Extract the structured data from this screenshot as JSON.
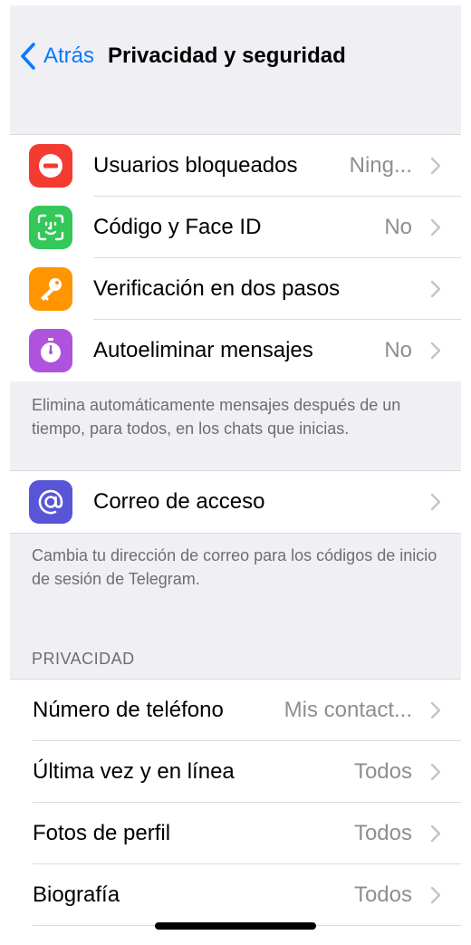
{
  "navbar": {
    "back_label": "Atrás",
    "title": "Privacidad y seguridad"
  },
  "security": {
    "items": [
      {
        "label": "Usuarios bloqueados",
        "value": "Ning...",
        "icon": "blocked-icon",
        "color": "#f43b30"
      },
      {
        "label": "Código y Face ID",
        "value": "No",
        "icon": "face-id-icon",
        "color": "#34c759"
      },
      {
        "label": "Verificación en dos pasos",
        "value": "",
        "icon": "key-icon",
        "color": "#ff9500"
      },
      {
        "label": "Autoeliminar mensajes",
        "value": "No",
        "icon": "stopwatch-icon",
        "color": "#af52de"
      }
    ],
    "footer": "Elimina automáticamente mensajes después de un tiempo, para todos, en los chats que inicias."
  },
  "login_email": {
    "label": "Correo de acceso",
    "icon": "at-icon",
    "color": "#5856d6",
    "footer": "Cambia tu dirección de correo para los códigos de inicio de sesión de Telegram."
  },
  "privacy": {
    "header": "PRIVACIDAD",
    "items": [
      {
        "label": "Número de teléfono",
        "value": "Mis contact..."
      },
      {
        "label": "Última vez y en línea",
        "value": "Todos"
      },
      {
        "label": "Fotos de perfil",
        "value": "Todos"
      },
      {
        "label": "Biografía",
        "value": "Todos"
      }
    ]
  },
  "colors": {
    "accent": "#0a7aff",
    "background": "#efeff4",
    "secondary_text": "#8e8e93"
  }
}
